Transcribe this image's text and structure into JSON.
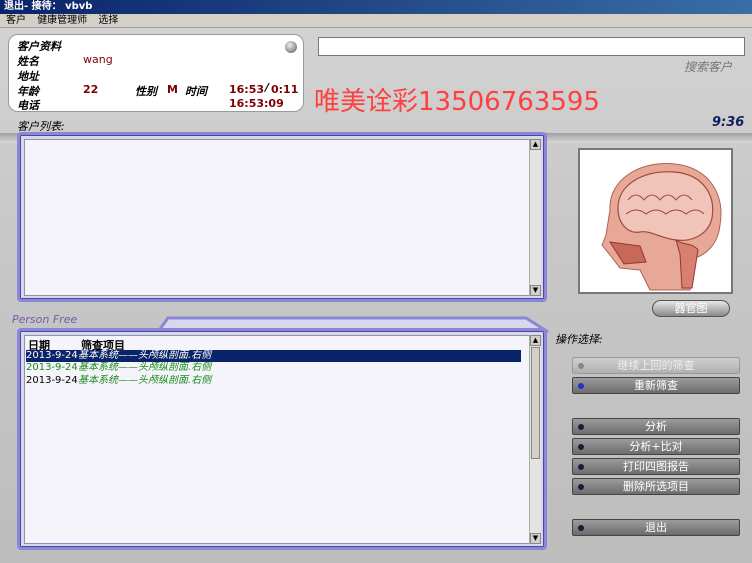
{
  "window": {
    "title": "退出- 接待： vbvb"
  },
  "menu": [
    "客户",
    "健康管理师",
    "选择"
  ],
  "customer_info": {
    "heading": "客户资料",
    "name_label": "姓名",
    "name_value": "wang",
    "address_label": "地址",
    "age_label": "年龄",
    "age_value": "22",
    "gender_label": "性别",
    "gender_value": "M",
    "time_label": "时间",
    "time_value": "16:53",
    "time_elapsed": "0:11",
    "phone_label": "电话",
    "clock_value": "16:53:09"
  },
  "search": {
    "value": "",
    "label": "搜索客户"
  },
  "watermark": "唯美诠彩13506763595",
  "clock": "9:36",
  "customer_list": {
    "label": "客户列表:"
  },
  "image_panel": {
    "button_label": "器官图"
  },
  "records": {
    "tag": "Person Free",
    "headers": {
      "date": "日期",
      "item": "筛查项目"
    },
    "rows": [
      {
        "date": "2013-9-24",
        "item": "基本系统——头颅纵剖面.右侧",
        "state": "selected"
      },
      {
        "date": "2013-9-24",
        "item": "基本系统——头颅纵剖面.右侧",
        "state": "green"
      },
      {
        "date": "2013-9-24",
        "item": "基本系统——头颅纵剖面.右侧",
        "state": "mixed"
      }
    ]
  },
  "operations": {
    "label": "操作选择:",
    "buttons": {
      "continue": "继续上回的筛查",
      "rescreen": "重新筛查",
      "analyze": "分析",
      "analyze_compare": "分析+比对",
      "print_report": "打印四图报告",
      "delete_selected": "删除所选项目",
      "exit": "退出"
    }
  },
  "colors": {
    "frame": "#8a86d8",
    "selected_row": "#0a246a",
    "green_text": "#1a8a1a",
    "value_text": "#800000"
  }
}
